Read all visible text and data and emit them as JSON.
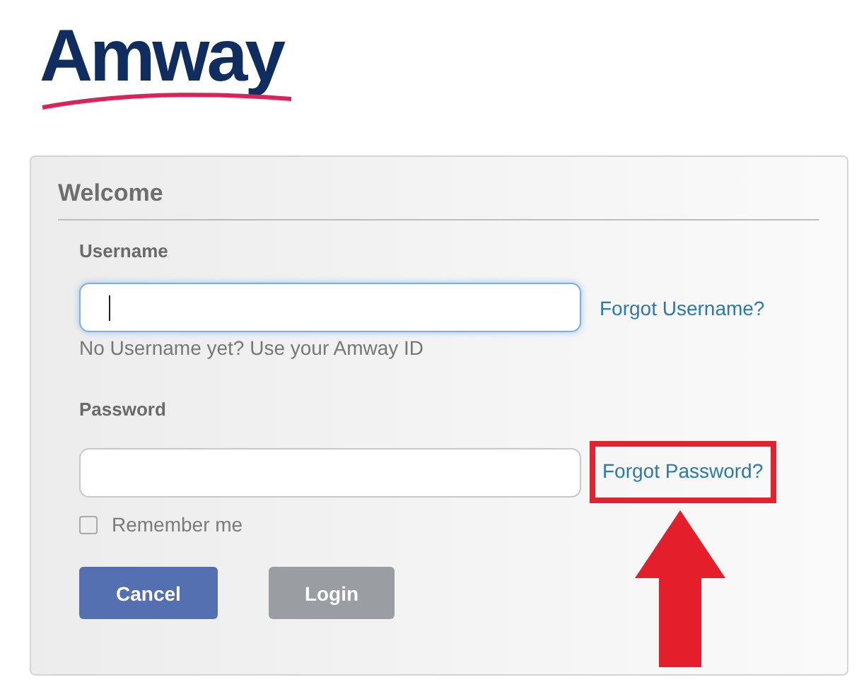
{
  "logo": {
    "text": "Amway"
  },
  "card": {
    "title": "Welcome",
    "username": {
      "label": "Username",
      "focused": true,
      "link": "Forgot Username?",
      "hint": "No Username yet? Use your Amway ID"
    },
    "password": {
      "label": "Password",
      "focused": false,
      "link": "Forgot Password?",
      "highlighted": true
    },
    "remember": {
      "label": "Remember me",
      "checked": false
    },
    "buttons": [
      {
        "label": "Cancel",
        "kind": "primary"
      },
      {
        "label": "Login",
        "kind": "secondary"
      }
    ]
  }
}
